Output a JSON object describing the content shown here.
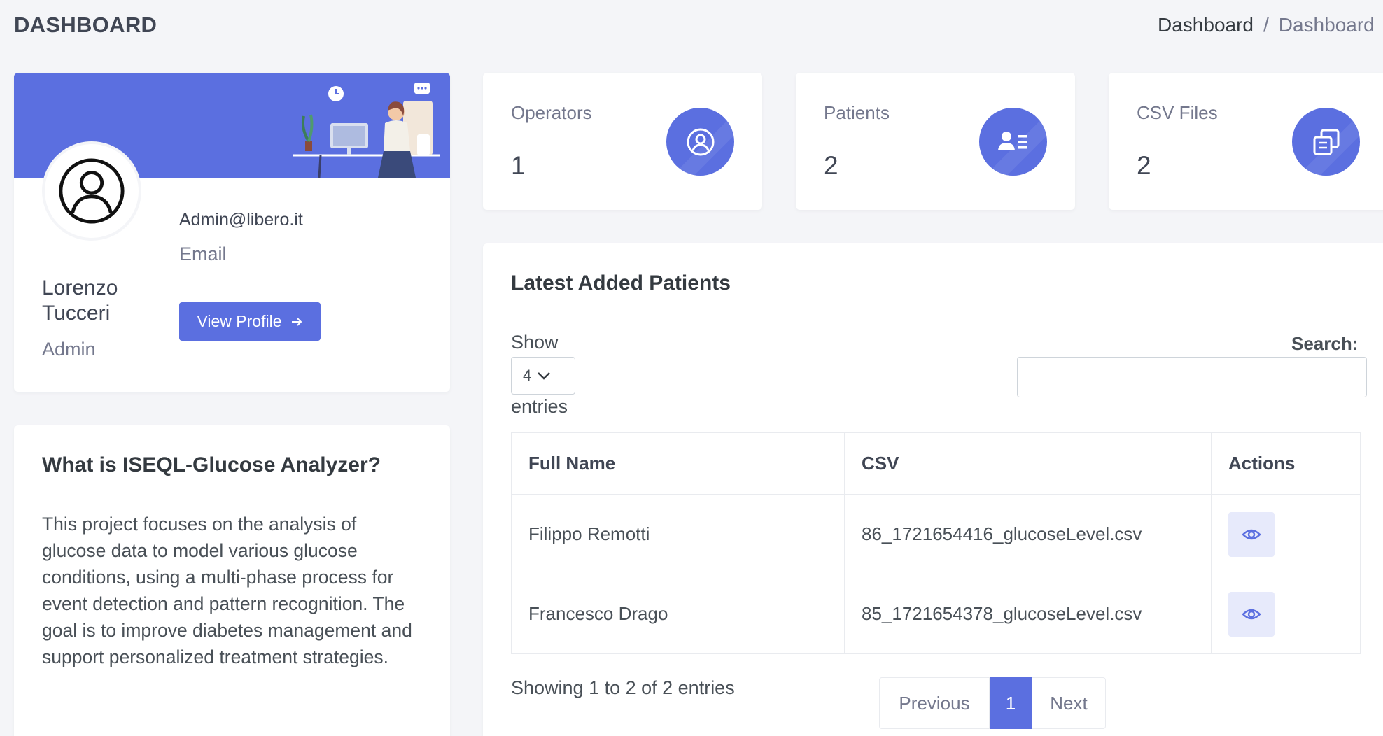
{
  "header": {
    "title": "DASHBOARD",
    "breadcrumb": [
      "Dashboard",
      "/",
      "Dashboard"
    ]
  },
  "profile": {
    "name": "Lorenzo Tucceri",
    "role": "Admin",
    "email": "Admin@libero.it",
    "email_label": "Email",
    "view_profile_label": "View Profile",
    "avatar_icon": "user-circle-icon",
    "banner_color": "#5b6fe0"
  },
  "stats": [
    {
      "label": "Operators",
      "value": "1",
      "icon": "user-circle-icon"
    },
    {
      "label": "Patients",
      "value": "2",
      "icon": "user-list-icon"
    },
    {
      "label": "CSV Files",
      "value": "2",
      "icon": "copy-files-icon"
    }
  ],
  "about": {
    "title": "What is ISEQL-Glucose Analyzer?",
    "text": "This project focuses on the analysis of glucose data to model various glucose conditions, using a multi-phase process for event detection and pattern recognition. The goal is to improve diabetes management and support personalized treatment strategies."
  },
  "patients_table": {
    "title": "Latest Added Patients",
    "show_label": "Show",
    "entries_value": "4",
    "entries_label": "entries",
    "search_label": "Search:",
    "search_value": "",
    "columns": [
      "Full Name",
      "CSV",
      "Actions"
    ],
    "rows": [
      {
        "name": "Filippo Remotti",
        "csv": "86_1721654416_glucoseLevel.csv",
        "action_icon": "eye-icon"
      },
      {
        "name": "Francesco Drago",
        "csv": "85_1721654378_glucoseLevel.csv",
        "action_icon": "eye-icon"
      }
    ],
    "info": "Showing 1 to 2 of 2 entries",
    "pagination": {
      "previous": "Previous",
      "current": "1",
      "next": "Next"
    }
  },
  "colors": {
    "accent": "#5b6fe0",
    "background": "#f4f5f8",
    "card": "#ffffff",
    "muted_text": "#74788d"
  }
}
